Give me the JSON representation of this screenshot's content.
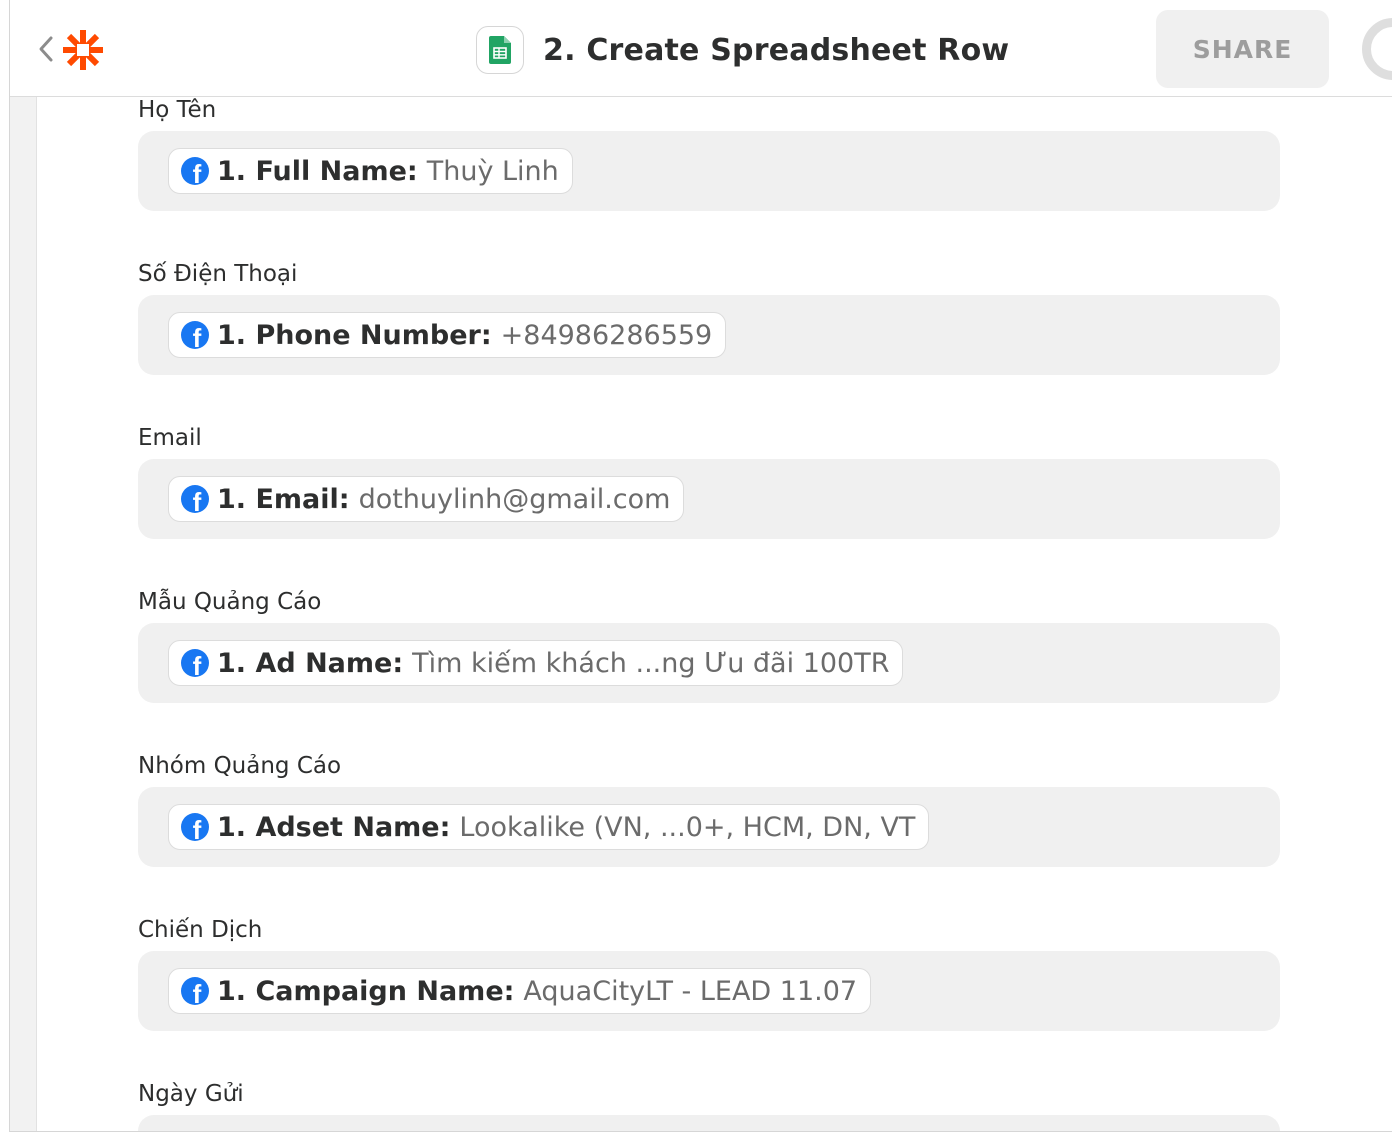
{
  "header": {
    "step_title": "2. Create Spreadsheet Row",
    "share_label": "SHARE"
  },
  "icons": {
    "back": "chevron-left-icon",
    "logo": "zapier-asterisk-logo",
    "app": "google-sheets-icon",
    "field_source": "facebook-icon"
  },
  "colors": {
    "brand_orange": "#ff4a00",
    "sheets_green": "#21a464",
    "facebook_blue": "#1877f2"
  },
  "fields": [
    {
      "label": "Họ Tên",
      "key": "1. Full Name:",
      "value": "Thuỳ Linh"
    },
    {
      "label": "Số Điện Thoại",
      "key": "1. Phone Number:",
      "value": "+84986286559"
    },
    {
      "label": "Email",
      "key": "1. Email:",
      "value": "dothuylinh@gmail.com"
    },
    {
      "label": "Mẫu Quảng Cáo",
      "key": "1. Ad Name:",
      "value": "Tìm kiếm khách ...ng Ưu đãi 100TR"
    },
    {
      "label": "Nhóm Quảng Cáo",
      "key": "1. Adset Name:",
      "value": "Lookalike (VN, ...0+, HCM, DN, VT"
    },
    {
      "label": "Chiến Dịch",
      "key": "1. Campaign Name:",
      "value": "AquaCityLT - LEAD 11.07"
    },
    {
      "label": "Ngày Gửi"
    }
  ]
}
